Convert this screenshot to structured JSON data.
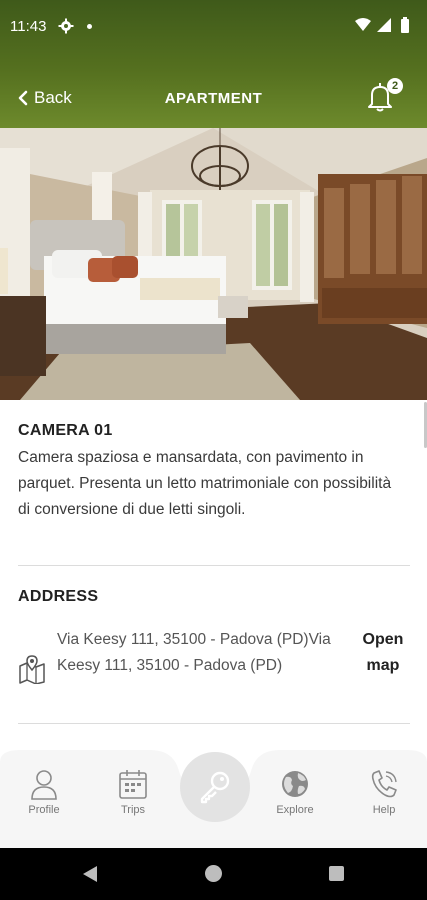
{
  "status_bar": {
    "time": "11:43"
  },
  "header": {
    "back_label": "Back",
    "title": "APARTMENT",
    "notification_count": "2"
  },
  "room": {
    "title": "CAMERA 01",
    "description": "Camera spaziosa e mansardata, con pavimento in parquet. Presenta un letto matrimoniale con possibilità di conversione di due letti singoli."
  },
  "address": {
    "title": "ADDRESS",
    "text": "Via Keesy 111, 35100 - Padova (PD)Via Keesy 111, 35100 - Padova (PD)",
    "open_map_label": "Open map"
  },
  "tabs": [
    {
      "label": "Profile",
      "icon": "person-icon"
    },
    {
      "label": "Trips",
      "icon": "calendar-icon"
    },
    {
      "label": "Explore",
      "icon": "globe-icon"
    },
    {
      "label": "Help",
      "icon": "phone-icon"
    }
  ],
  "center_action": {
    "icon": "key-icon"
  },
  "colors": {
    "header_dark": "#3f5a1a",
    "header_light": "#6d8a2c",
    "tab_text": "#777777"
  }
}
